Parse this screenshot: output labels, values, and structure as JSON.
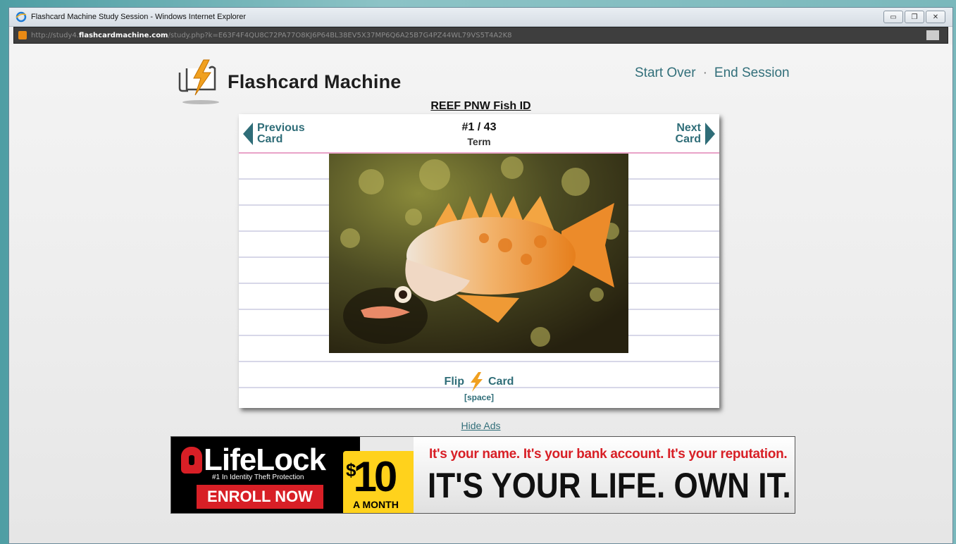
{
  "window": {
    "title": "Flashcard Machine Study Session - Windows Internet Explorer",
    "controls": {
      "minimize": "▭",
      "restore": "❐",
      "close": "✕"
    }
  },
  "address": {
    "prefix": "http://study4.",
    "host": "flashcardmachine.com",
    "path": "/study.php?k=E63F4F4QU8C72PA77O8KJ6P64BL38EV5X37MP6Q6A25B7G4PZ44WL79VS5T4A2K8"
  },
  "header": {
    "logo_text": "Flashcard Machine",
    "nav": {
      "start_over": "Start Over",
      "separator": "·",
      "end_session": "End Session"
    }
  },
  "deck": {
    "title": "REEF PNW Fish ID"
  },
  "card": {
    "prev_label_1": "Previous",
    "prev_label_2": "Card",
    "next_label_1": "Next",
    "next_label_2": "Card",
    "counter": "#1 / 43",
    "side": "Term",
    "flip_left": "Flip",
    "flip_right": "Card",
    "flip_key": "[space]"
  },
  "ads": {
    "hide_label": "Hide Ads",
    "brand": "LifeLock",
    "tagline": "#1 In Identity Theft Protection",
    "enroll": "ENROLL NOW",
    "price_symbol": "$",
    "price_amount": "10",
    "price_period": "A MONTH",
    "line1": "It's your name.   It's your bank account.   It's your reputation.",
    "line2": "IT'S YOUR LIFE. OWN IT."
  },
  "colors": {
    "accent": "#2f6d78",
    "lightning": "#f0a020",
    "ad_red": "#d81f26",
    "ad_yellow": "#ffd21c"
  },
  "icons": [
    "ie-icon",
    "favicon",
    "lightning-icon",
    "arrow-left-icon",
    "arrow-right-icon",
    "lock-icon"
  ]
}
